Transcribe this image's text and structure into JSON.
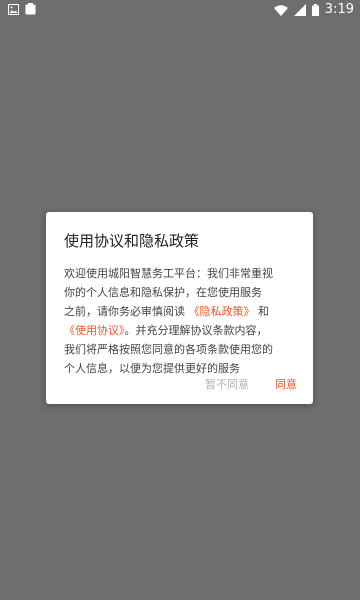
{
  "status_bar": {
    "time": "3:19",
    "left_icons": [
      "photo-icon",
      "clipboard-icon"
    ],
    "right_icons": [
      "wifi-icon",
      "signal-icon",
      "battery-icon"
    ]
  },
  "dialog": {
    "title": "使用协议和隐私政策",
    "body": {
      "line1": "欢迎使用城阳智慧务工平台：我们非常重视",
      "line2": "你的个人信息和隐私保护，在您使用服务",
      "line3_prefix": "之前，请你务必审慎阅读",
      "privacy_link": "《隐私政策》",
      "line3_connector": "和",
      "agreement_link": "《使用协议》",
      "line4_suffix": "。并充分理解协议条款内容，",
      "line5": "我们将严格按照您同意的各项条款使用您的",
      "line6": "个人信息，以便为您提供更好的服务"
    },
    "decline_label": "暂不同意",
    "agree_label": "同意"
  },
  "colors": {
    "overlay": "#6e6e6e",
    "accent": "#e8582c",
    "muted_button": "#b3b3b3"
  }
}
